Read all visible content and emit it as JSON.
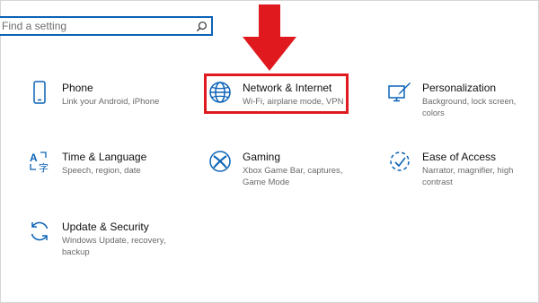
{
  "search": {
    "placeholder": "Find a setting"
  },
  "tiles": [
    {
      "title": "Phone",
      "desc": "Link your Android, iPhone"
    },
    {
      "title": "Network & Internet",
      "desc": "Wi-Fi, airplane mode, VPN"
    },
    {
      "title": "Personalization",
      "desc": "Background, lock screen, colors"
    },
    {
      "title": "Time & Language",
      "desc": "Speech, region, date"
    },
    {
      "title": "Gaming",
      "desc": "Xbox Game Bar, captures, Game Mode"
    },
    {
      "title": "Ease of Access",
      "desc": "Narrator, magnifier, high contrast"
    },
    {
      "title": "Update & Security",
      "desc": "Windows Update, recovery, backup"
    }
  ],
  "icons": [
    "phone-icon",
    "globe-icon",
    "paintbrush-icon",
    "language-icon",
    "xbox-icon",
    "ease-of-access-icon",
    "refresh-icon"
  ],
  "colors": {
    "accent": "#0c63b7",
    "highlight": "#e0191e",
    "arrow": "#e0191e"
  }
}
